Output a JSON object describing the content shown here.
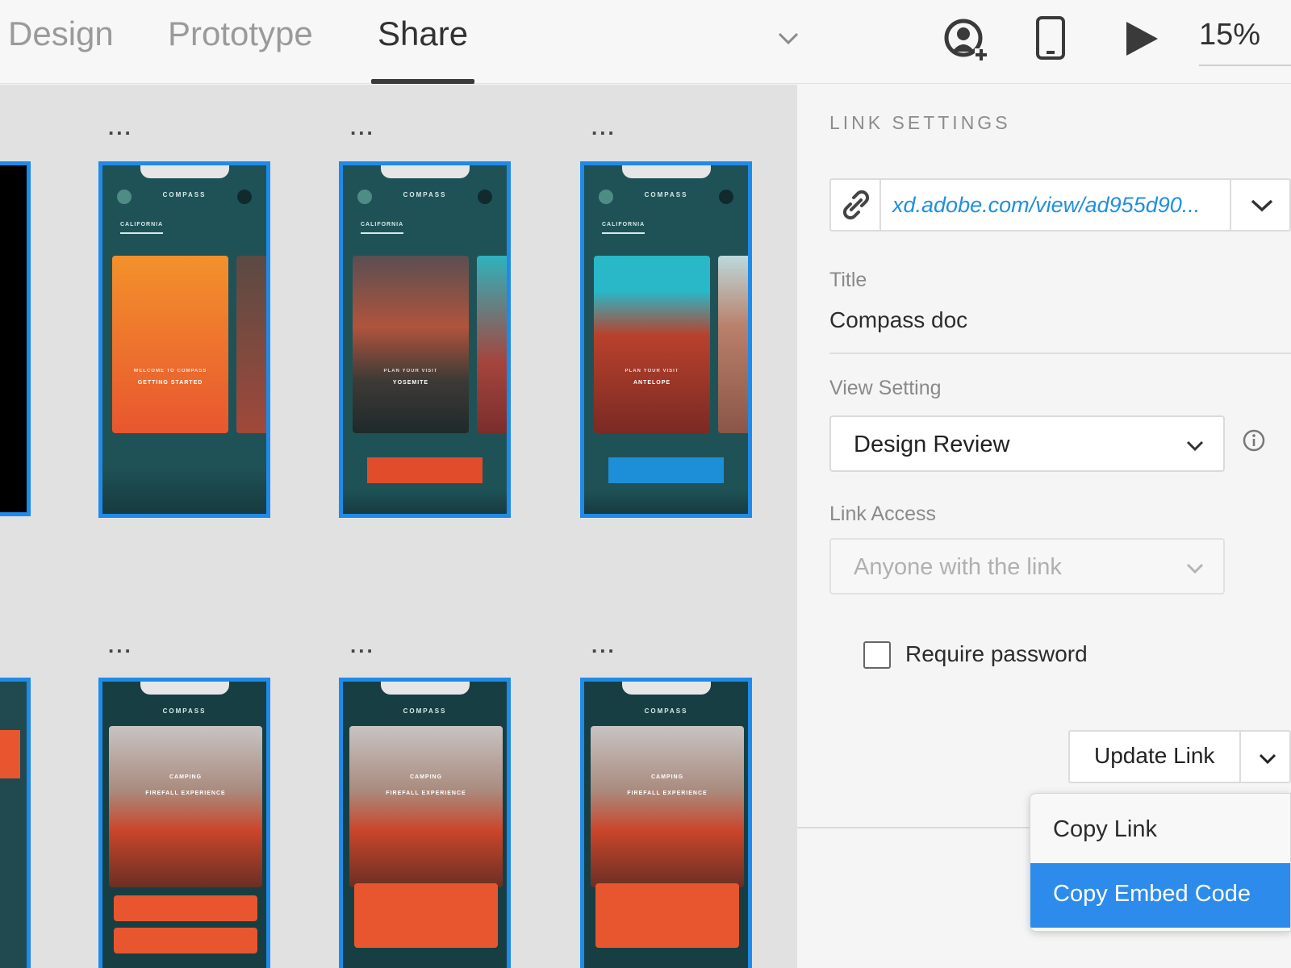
{
  "toolbar": {
    "tabs": [
      {
        "label": "Design",
        "active": false
      },
      {
        "label": "Prototype",
        "active": false
      },
      {
        "label": "Share",
        "active": true
      }
    ],
    "icons": [
      "invite-user-icon",
      "mobile-preview-icon",
      "play-icon"
    ],
    "zoom": "15%"
  },
  "canvas": {
    "artboard_more": "...",
    "top_row": [
      {
        "app_title": "COMPASS",
        "subtitle": "CALIFORNIA",
        "card_caption": "GETTING STARTED",
        "card_kicker": "WELCOME TO COMPASS"
      },
      {
        "app_title": "COMPASS",
        "subtitle": "CALIFORNIA",
        "card_caption": "YOSEMITE",
        "card_kicker": "PLAN YOUR VISIT"
      },
      {
        "app_title": "COMPASS",
        "subtitle": "CALIFORNIA",
        "card_caption": "ANTELOPE",
        "card_kicker": "PLAN YOUR VISIT"
      }
    ],
    "bottom_row": [
      {
        "app_title": "COMPASS",
        "caption": "CAMPING",
        "caption2": "FIREFALL EXPERIENCE"
      },
      {
        "app_title": "COMPASS",
        "caption": "CAMPING",
        "caption2": "FIREFALL EXPERIENCE"
      },
      {
        "app_title": "COMPASS",
        "caption": "CAMPING",
        "caption2": "FIREFALL EXPERIENCE"
      }
    ]
  },
  "panel": {
    "title": "LINK SETTINGS",
    "link_url": "xd.adobe.com/view/ad955d90...",
    "title_label": "Title",
    "title_value": "Compass doc",
    "view_setting_label": "View Setting",
    "view_setting_value": "Design Review",
    "link_access_label": "Link Access",
    "link_access_value": "Anyone with the link",
    "require_password_label": "Require password",
    "update_link_label": "Update Link",
    "menu": [
      {
        "label": "Copy Link",
        "highlighted": false
      },
      {
        "label": "Copy Embed Code",
        "highlighted": true
      }
    ]
  },
  "colors": {
    "accent": "#2d8ceb",
    "link": "#1f8fe0",
    "artboard_border": "#1e8bea",
    "orange": "#e8562f"
  }
}
